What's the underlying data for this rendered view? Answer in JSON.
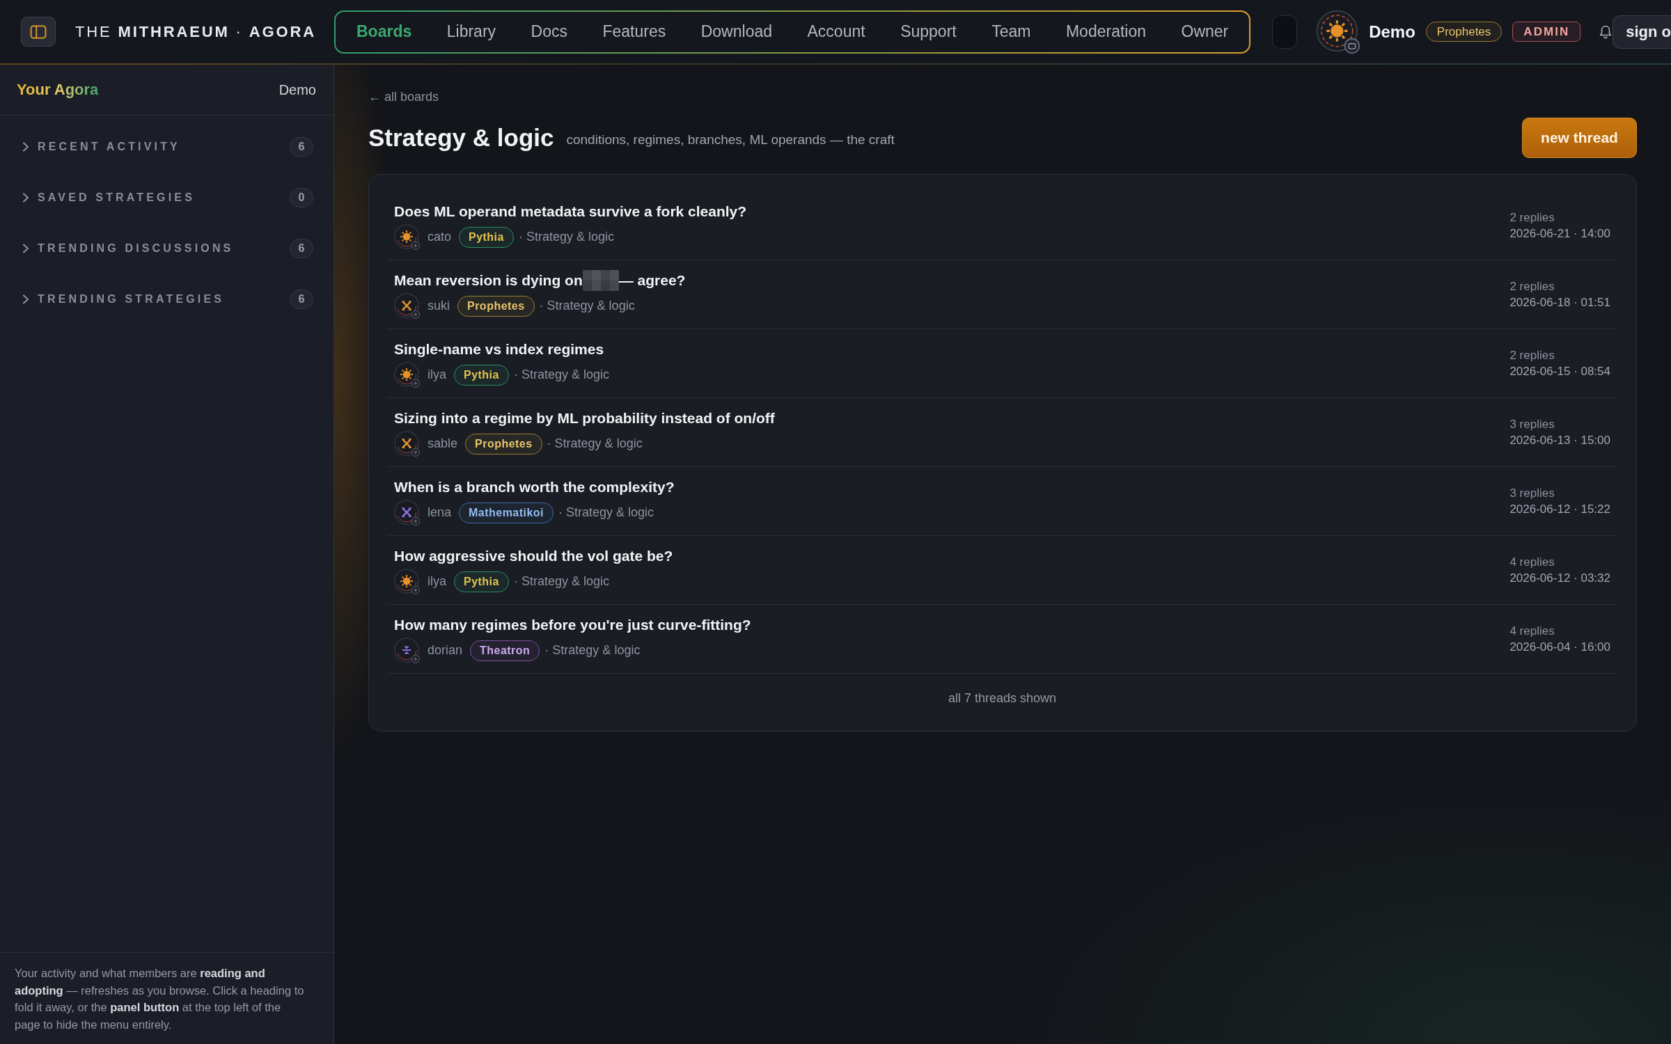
{
  "topbar": {
    "logo": "THE **MITHRAEUM** · **AGORA**",
    "nav": [
      {
        "label": "Boards",
        "selected": true
      },
      {
        "label": "Library",
        "selected": false
      },
      {
        "label": "Docs",
        "selected": false
      },
      {
        "label": "Features",
        "selected": false
      },
      {
        "label": "Download",
        "selected": false
      },
      {
        "label": "Account",
        "selected": false
      },
      {
        "label": "Support",
        "selected": false
      },
      {
        "label": "Team",
        "selected": false
      },
      {
        "label": "Moderation",
        "selected": false
      },
      {
        "label": "Owner",
        "selected": false
      }
    ],
    "user": {
      "avatar": {
        "kind": "sun",
        "color": "#e8912a"
      },
      "name": "Demo",
      "badges": [
        {
          "label": "Prophetes",
          "kind": "prophetes"
        },
        {
          "label": "ADMIN",
          "kind": "admin"
        }
      ]
    },
    "sign_out": "sign o"
  },
  "sidebar": {
    "title": "Your Agora",
    "user": "Demo",
    "sections": [
      {
        "label": "RECENT ACTIVITY",
        "count": "6",
        "expanded": false
      },
      {
        "label": "SAVED STRATEGIES",
        "count": "0",
        "expanded": false
      },
      {
        "label": "TRENDING DISCUSSIONS",
        "count": "6",
        "expanded": false
      },
      {
        "label": "TRENDING STRATEGIES",
        "count": "6",
        "expanded": false
      }
    ],
    "note": "Your activity and what members are **reading and adopting** — refreshes as you browse. Click a heading to fold it away, or the **panel button** at the top left of the page to hide the menu entirely."
  },
  "board": {
    "back_link": "← all boards",
    "title": "Strategy & logic",
    "subtitle": "conditions, regimes, branches, ML operands — the craft",
    "new_thread": "new thread"
  },
  "threads": [
    {
      "title": "Does ML operand metadata survive a fork cleanly?",
      "redacted": false,
      "author": "cato",
      "avatar": {
        "kind": "sun",
        "color": "#e8912a"
      },
      "badge": {
        "label": "Pythia",
        "kind": "pythia"
      },
      "board": "· Strategy & logic",
      "replies": "2 replies",
      "date": "2026-06-21 · 14:00"
    },
    {
      "title": "Mean reversion is dying on",
      "redacted": true,
      "title_tail": "— agree?",
      "author": "suki",
      "avatar": {
        "kind": "cross",
        "color": "#e8912a"
      },
      "badge": {
        "label": "Prophetes",
        "kind": "prophetes"
      },
      "board": "· Strategy & logic",
      "replies": "2 replies",
      "date": "2026-06-18 · 01:51"
    },
    {
      "title": "Single-name vs index regimes",
      "redacted": false,
      "author": "ilya",
      "avatar": {
        "kind": "sun",
        "color": "#e8912a"
      },
      "badge": {
        "label": "Pythia",
        "kind": "pythia"
      },
      "board": "· Strategy & logic",
      "replies": "2 replies",
      "date": "2026-06-15 · 08:54"
    },
    {
      "title": "Sizing into a regime by ML probability instead of on/off",
      "redacted": false,
      "author": "sable",
      "avatar": {
        "kind": "cross",
        "color": "#e8912a"
      },
      "badge": {
        "label": "Prophetes",
        "kind": "prophetes"
      },
      "board": "· Strategy & logic",
      "replies": "3 replies",
      "date": "2026-06-13 · 15:00"
    },
    {
      "title": "When is a branch worth the complexity?",
      "redacted": false,
      "author": "lena",
      "avatar": {
        "kind": "cross",
        "color": "#8f72e6"
      },
      "badge": {
        "label": "Mathematikoi",
        "kind": "mathematikoi"
      },
      "board": "· Strategy & logic",
      "replies": "3 replies",
      "date": "2026-06-12 · 15:22"
    },
    {
      "title": "How aggressive should the vol gate be?",
      "redacted": false,
      "author": "ilya",
      "avatar": {
        "kind": "sun",
        "color": "#e8912a"
      },
      "badge": {
        "label": "Pythia",
        "kind": "pythia"
      },
      "board": "· Strategy & logic",
      "replies": "4 replies",
      "date": "2026-06-12 · 03:32"
    },
    {
      "title": "How many regimes before you're just curve-fitting?",
      "redacted": false,
      "author": "dorian",
      "avatar": {
        "kind": "sigil",
        "color": "#8f72e6"
      },
      "badge": {
        "label": "Theatron",
        "kind": "theatron"
      },
      "board": "· Strategy & logic",
      "replies": "4 replies",
      "date": "2026-06-04 · 16:00"
    }
  ],
  "footer": "all 7 threads shown"
}
